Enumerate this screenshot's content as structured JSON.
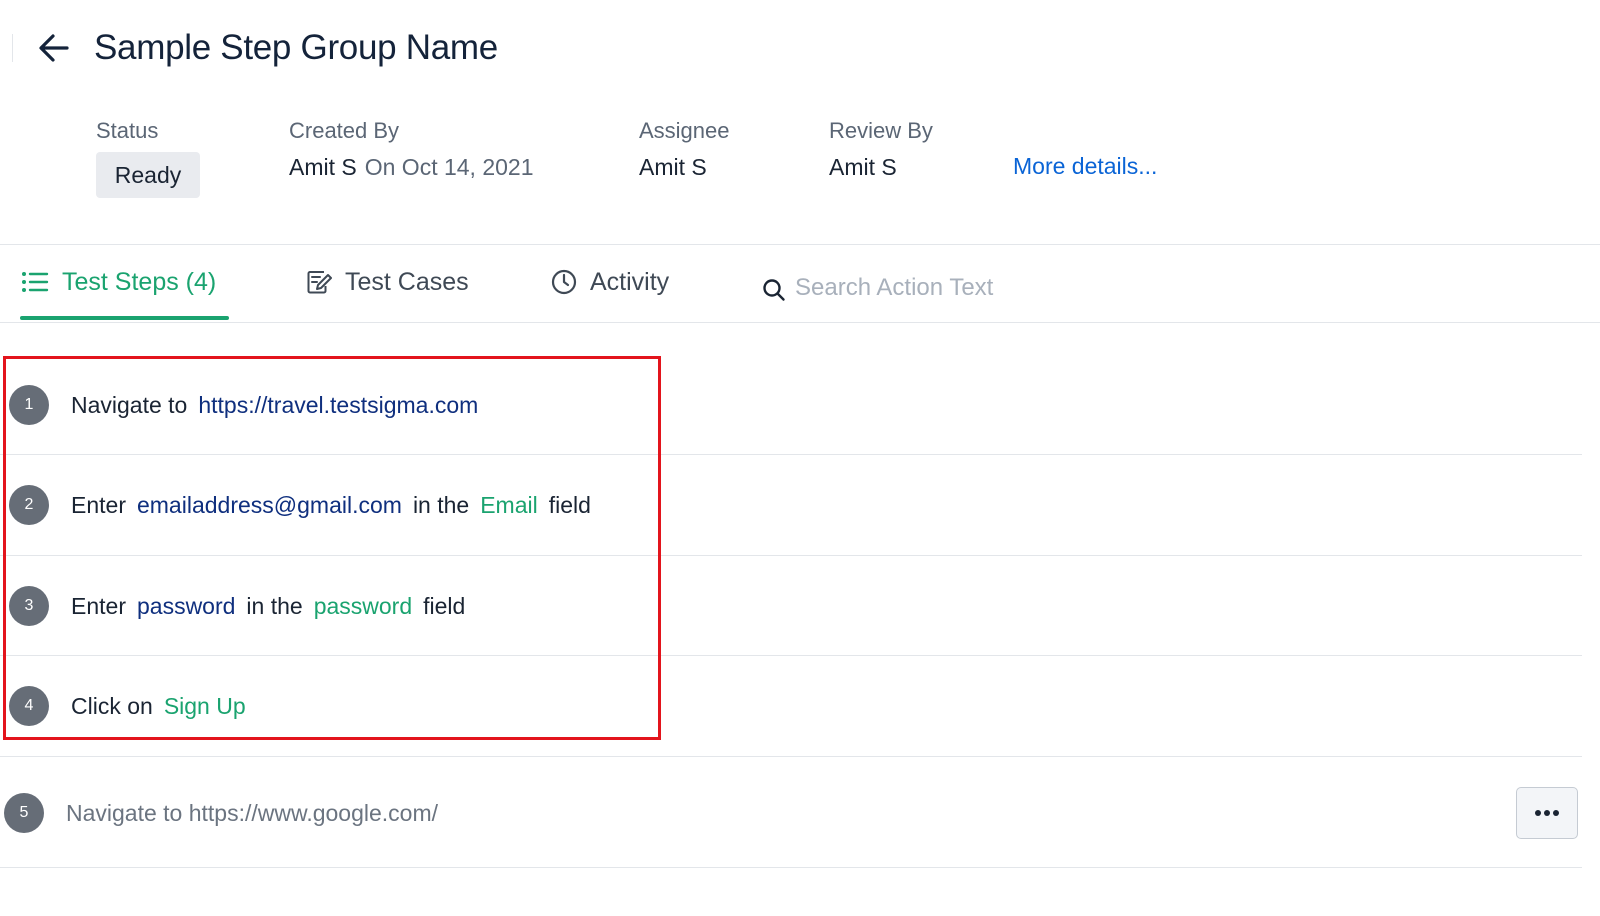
{
  "header": {
    "title": "Sample Step Group Name",
    "back_icon": "arrow-left-icon"
  },
  "meta": {
    "status_label": "Status",
    "status_value": "Ready",
    "created_by_label": "Created By",
    "created_by_value": "Amit S",
    "created_on": "On Oct 14, 2021",
    "assignee_label": "Assignee",
    "assignee_value": "Amit S",
    "review_by_label": "Review By",
    "review_by_value": "Amit S",
    "more_details": "More details..."
  },
  "tabs": [
    {
      "label": "Test Steps (4)",
      "icon": "list-icon",
      "active": true
    },
    {
      "label": "Test Cases",
      "icon": "edit-note-icon",
      "active": false
    },
    {
      "label": "Activity",
      "icon": "clock-icon",
      "active": false
    }
  ],
  "search": {
    "placeholder": "Search Action Text",
    "value": "",
    "icon": "search-icon"
  },
  "steps": [
    {
      "number": "1",
      "parts": [
        {
          "text": "Navigate to",
          "style": "plain"
        },
        {
          "text": "https://travel.testsigma.com",
          "style": "blue"
        }
      ]
    },
    {
      "number": "2",
      "parts": [
        {
          "text": "Enter",
          "style": "plain"
        },
        {
          "text": "emailaddress@gmail.com",
          "style": "blue"
        },
        {
          "text": "in the",
          "style": "plain"
        },
        {
          "text": "Email",
          "style": "green"
        },
        {
          "text": "field",
          "style": "plain"
        }
      ]
    },
    {
      "number": "3",
      "parts": [
        {
          "text": "Enter",
          "style": "plain"
        },
        {
          "text": "password",
          "style": "blue"
        },
        {
          "text": "in the",
          "style": "plain"
        },
        {
          "text": "password",
          "style": "green"
        },
        {
          "text": "field",
          "style": "plain"
        }
      ]
    },
    {
      "number": "4",
      "parts": [
        {
          "text": "Click on",
          "style": "plain"
        },
        {
          "text": "Sign Up",
          "style": "green"
        }
      ]
    },
    {
      "number": "5",
      "parts": [
        {
          "text": "Navigate to https://www.google.com/",
          "style": "muted"
        }
      ]
    }
  ],
  "colors": {
    "accent_green": "#1aa36f",
    "link_blue": "#0a64d6",
    "test_data_blue": "#0f2f7e",
    "highlight_red": "#e3141c",
    "step_circle": "#666d77"
  },
  "more_actions_icon": "more-horizontal-icon"
}
